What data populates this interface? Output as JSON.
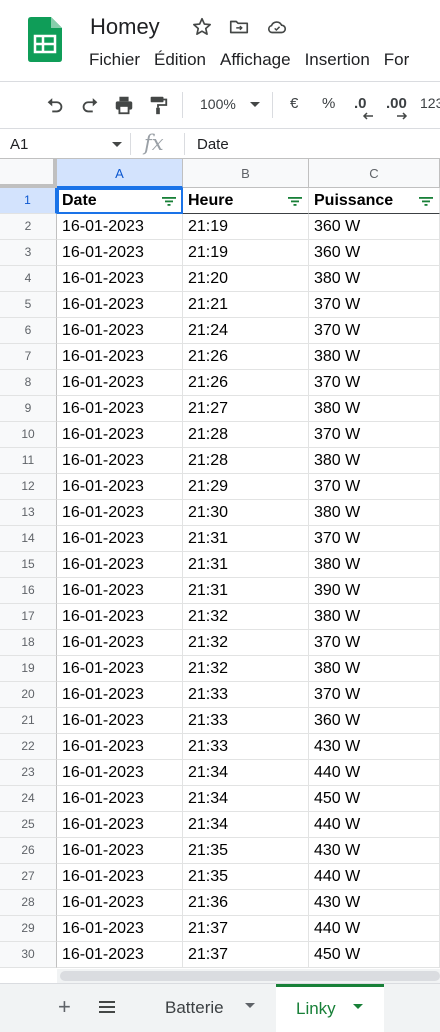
{
  "app": {
    "doc_title": "Homey",
    "brand_color": "#0f9d58",
    "menu": [
      "Fichier",
      "Édition",
      "Affichage",
      "Insertion",
      "For"
    ],
    "title_icons": [
      "star-icon",
      "move-folder-icon",
      "cloud-status-icon"
    ]
  },
  "toolbar": {
    "zoom": "100%",
    "currency": "€",
    "percent": "%",
    "decrease_decimals": ".0",
    "increase_decimals": ".00",
    "more_formats": "123"
  },
  "formula_bar": {
    "name_box": "A1",
    "fx": "fx",
    "content": "Date"
  },
  "grid": {
    "columns": [
      "A",
      "B",
      "C"
    ],
    "selected_cell": "A1",
    "header_row": [
      "Date",
      "Heure",
      "Puissance"
    ],
    "rows": [
      {
        "n": "1"
      },
      {
        "n": "2",
        "date": "16-01-2023",
        "time": "21:19",
        "power": "360 W"
      },
      {
        "n": "3",
        "date": "16-01-2023",
        "time": "21:19",
        "power": "360 W"
      },
      {
        "n": "4",
        "date": "16-01-2023",
        "time": "21:20",
        "power": "380 W"
      },
      {
        "n": "5",
        "date": "16-01-2023",
        "time": "21:21",
        "power": "370 W"
      },
      {
        "n": "6",
        "date": "16-01-2023",
        "time": "21:24",
        "power": "370 W"
      },
      {
        "n": "7",
        "date": "16-01-2023",
        "time": "21:26",
        "power": "380 W"
      },
      {
        "n": "8",
        "date": "16-01-2023",
        "time": "21:26",
        "power": "370 W"
      },
      {
        "n": "9",
        "date": "16-01-2023",
        "time": "21:27",
        "power": "380 W"
      },
      {
        "n": "10",
        "date": "16-01-2023",
        "time": "21:28",
        "power": "370 W"
      },
      {
        "n": "11",
        "date": "16-01-2023",
        "time": "21:28",
        "power": "380 W"
      },
      {
        "n": "12",
        "date": "16-01-2023",
        "time": "21:29",
        "power": "370 W"
      },
      {
        "n": "13",
        "date": "16-01-2023",
        "time": "21:30",
        "power": "380 W"
      },
      {
        "n": "14",
        "date": "16-01-2023",
        "time": "21:31",
        "power": "370 W"
      },
      {
        "n": "15",
        "date": "16-01-2023",
        "time": "21:31",
        "power": "380 W"
      },
      {
        "n": "16",
        "date": "16-01-2023",
        "time": "21:31",
        "power": "390 W"
      },
      {
        "n": "17",
        "date": "16-01-2023",
        "time": "21:32",
        "power": "380 W"
      },
      {
        "n": "18",
        "date": "16-01-2023",
        "time": "21:32",
        "power": "370 W"
      },
      {
        "n": "19",
        "date": "16-01-2023",
        "time": "21:32",
        "power": "380 W"
      },
      {
        "n": "20",
        "date": "16-01-2023",
        "time": "21:33",
        "power": "370 W"
      },
      {
        "n": "21",
        "date": "16-01-2023",
        "time": "21:33",
        "power": "360 W"
      },
      {
        "n": "22",
        "date": "16-01-2023",
        "time": "21:33",
        "power": "430 W"
      },
      {
        "n": "23",
        "date": "16-01-2023",
        "time": "21:34",
        "power": "440 W"
      },
      {
        "n": "24",
        "date": "16-01-2023",
        "time": "21:34",
        "power": "450 W"
      },
      {
        "n": "25",
        "date": "16-01-2023",
        "time": "21:34",
        "power": "440 W"
      },
      {
        "n": "26",
        "date": "16-01-2023",
        "time": "21:35",
        "power": "430 W"
      },
      {
        "n": "27",
        "date": "16-01-2023",
        "time": "21:35",
        "power": "440 W"
      },
      {
        "n": "28",
        "date": "16-01-2023",
        "time": "21:36",
        "power": "430 W"
      },
      {
        "n": "29",
        "date": "16-01-2023",
        "time": "21:37",
        "power": "440 W"
      },
      {
        "n": "30",
        "date": "16-01-2023",
        "time": "21:37",
        "power": "450 W"
      }
    ]
  },
  "sheets": {
    "add_icon": "plus-icon",
    "list_icon": "all-sheets-icon",
    "tabs": [
      {
        "label": "Batterie",
        "active": false
      },
      {
        "label": "Linky",
        "active": true
      }
    ],
    "active_color": "#188038"
  }
}
